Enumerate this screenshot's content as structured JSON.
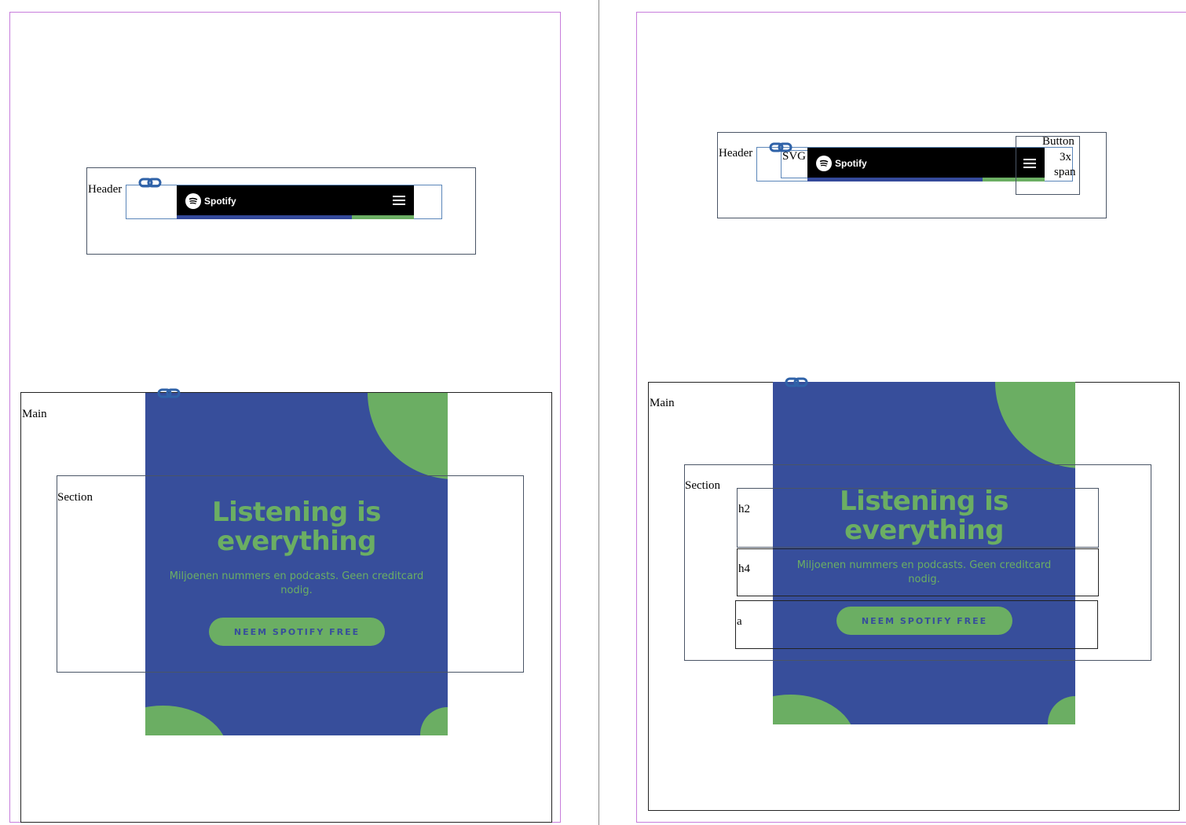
{
  "labels": {
    "header": "Header",
    "main": "Main",
    "section": "Section",
    "svg": "SVG",
    "button": "Button",
    "spans": "3x",
    "span": "span",
    "h2": "h2",
    "h4": "h4",
    "a": "a"
  },
  "spotify": {
    "logo_text": "Spotify",
    "headline": "Listening is everything",
    "subhead": "Miljoenen nummers en podcasts. Geen creditcard nodig.",
    "cta": "NEEM SPOTIFY FREE"
  },
  "colors": {
    "hero_blue": "#374e9b",
    "spotify_green": "#6bae63",
    "header_black": "#000000",
    "page_border": "#c77ddb"
  },
  "icons": [
    "link-icon",
    "spotify-logo-icon",
    "hamburger-icon"
  ]
}
